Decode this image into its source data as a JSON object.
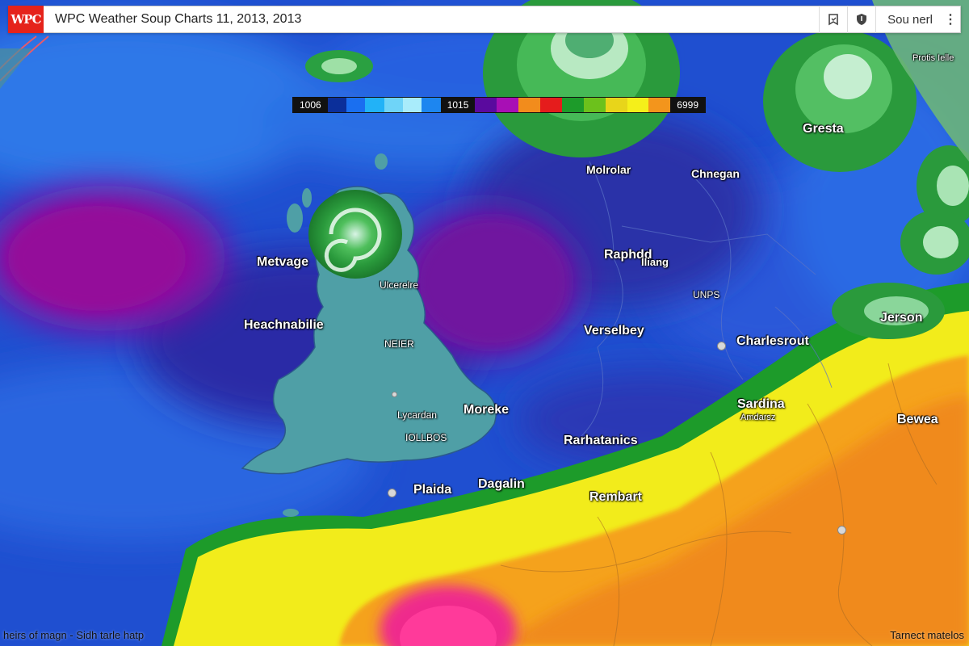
{
  "header": {
    "logo": "WPC",
    "title": "WPC Weather Soup Charts 11, 2013, 2013",
    "sign_in": "Sou nerl",
    "icons": [
      "bookmark-icon",
      "shield-icon",
      "kebab-menu-icon"
    ]
  },
  "legend": {
    "label_left": "1006",
    "label_mid": "1015",
    "label_right": "6999",
    "colors_low": [
      "#0b2f9a",
      "#1a6ff0",
      "#22b2f7",
      "#6fd4f8",
      "#a9ecfb",
      "#1d86f0"
    ],
    "colors_high": [
      "#5a0a9e",
      "#a80fb5",
      "#f28c1c",
      "#e51c1c",
      "#1d9b2a",
      "#6cc11c",
      "#e8d51a",
      "#f5ef1a",
      "#f3951c"
    ]
  },
  "places": [
    {
      "name": "Metvage",
      "size": "large"
    },
    {
      "name": "Heachnabilie",
      "size": "large"
    },
    {
      "name": "Ulcerelre",
      "size": "small"
    },
    {
      "name": "NEIER",
      "size": "small"
    },
    {
      "name": "Lycardan",
      "size": "small"
    },
    {
      "name": "IOLLBOS",
      "size": "small"
    },
    {
      "name": "Moreke",
      "size": "large"
    },
    {
      "name": "Plaida",
      "size": "large"
    },
    {
      "name": "Dagalin",
      "size": "large"
    },
    {
      "name": "Molrolar",
      "size": "large"
    },
    {
      "name": "Chnegan",
      "size": "large"
    },
    {
      "name": "Raphdd",
      "size": "large"
    },
    {
      "name": "Iliang",
      "size": "large"
    },
    {
      "name": "UNPS",
      "size": "small"
    },
    {
      "name": "Verselbey",
      "size": "large"
    },
    {
      "name": "Charlesrout",
      "size": "large"
    },
    {
      "name": "Rarhatanics",
      "size": "large"
    },
    {
      "name": "Sardina",
      "size": "large"
    },
    {
      "name": "Amdarsz",
      "size": "small"
    },
    {
      "name": "Rembart",
      "size": "large"
    },
    {
      "name": "Bewea",
      "size": "large"
    },
    {
      "name": "Jerson",
      "size": "large"
    },
    {
      "name": "Gresta",
      "size": "large"
    },
    {
      "name": "Protis Ielle",
      "size": "small"
    }
  ],
  "footer": {
    "left": "heirs of magn - Sidh tarle hatp",
    "right": "Tarnect matelos"
  }
}
